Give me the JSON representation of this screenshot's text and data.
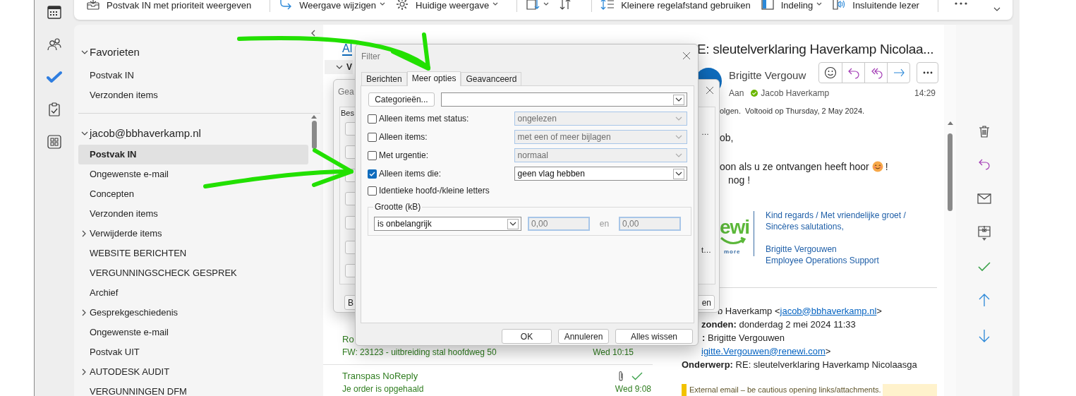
{
  "ribbon": {
    "items": [
      {
        "kind": "command",
        "label": "Postvak IN met prioriteit weergeven",
        "dropdown": false
      },
      {
        "kind": "separator"
      },
      {
        "kind": "command",
        "label": "Weergave wijzigen",
        "dropdown": true
      },
      {
        "kind": "command",
        "label": "Huidige weergave",
        "dropdown": true
      },
      {
        "kind": "separator"
      },
      {
        "kind": "icon",
        "dropdown": true
      },
      {
        "kind": "icon",
        "dropdown": false
      },
      {
        "kind": "separator"
      },
      {
        "kind": "command",
        "label": "Kleinere regelafstand gebruiken",
        "dropdown": false
      },
      {
        "kind": "command",
        "label": "Indeling",
        "dropdown": true
      },
      {
        "kind": "command",
        "label": "Insluitende lezer",
        "dropdown": false
      },
      {
        "kind": "separator"
      },
      {
        "kind": "more"
      }
    ]
  },
  "folder_pane": {
    "favorites": {
      "title": "Favorieten",
      "expanded": true,
      "items": [
        {
          "label": "Postvak IN",
          "selected": false
        },
        {
          "label": "Verzonden items",
          "selected": false
        }
      ]
    },
    "account": {
      "title": "jacob@bbhaverkamp.nl",
      "expanded": true,
      "folders": [
        {
          "label": "Postvak IN",
          "selected": true,
          "has_subfolders": false
        },
        {
          "label": "Ongewenste e-mail",
          "selected": false,
          "has_subfolders": false
        },
        {
          "label": "Concepten",
          "selected": false,
          "has_subfolders": false
        },
        {
          "label": "Verzonden items",
          "selected": false,
          "has_subfolders": false
        },
        {
          "label": "Verwijderde items",
          "selected": false,
          "has_subfolders": true
        },
        {
          "label": "WEBSITE BERICHTEN",
          "selected": false,
          "has_subfolders": false
        },
        {
          "label": "VERGUNNINGSCHECK GESPREK",
          "selected": false,
          "has_subfolders": false
        },
        {
          "label": "Archief",
          "selected": false,
          "has_subfolders": false
        },
        {
          "label": "Gesprekgeschiedenis",
          "selected": false,
          "has_subfolders": true
        },
        {
          "label": "Ongewenste e-mail",
          "selected": false,
          "has_subfolders": false
        },
        {
          "label": "Postvak UIT",
          "selected": false,
          "has_subfolders": false
        },
        {
          "label": "AUTODESK AUDIT",
          "selected": false,
          "has_subfolders": true
        },
        {
          "label": "VERGUNNINGEN DFM",
          "selected": false,
          "has_subfolders": false
        }
      ]
    }
  },
  "message_list": {
    "tab": "Al",
    "group_header": "V",
    "rows": [
      {
        "sender": "Ro",
        "subject": "FW: 23123 - uitbreiding stal hoofdweg 50",
        "time": "Wed 10:15"
      },
      {
        "sender": "Transpas NoReply",
        "subject": "Je order is opgehaald",
        "time": "Wed 9:08",
        "attachment": true,
        "completed": true
      }
    ]
  },
  "background_dialog": {
    "title": "Gea",
    "group_title": "Bes",
    "texts": [
      "…",
      "t…"
    ],
    "buttons": [
      "B",
      "en"
    ]
  },
  "filter_dialog": {
    "title": "Filter",
    "tabs": [
      {
        "label": "Berichten",
        "selected": false
      },
      {
        "label": "Meer opties",
        "selected": true
      },
      {
        "label": "Geavanceerd",
        "selected": false
      }
    ],
    "categories_button": "Categorieën...",
    "criteria": [
      {
        "label": "Alleen items met status:",
        "checked": false,
        "value": "ongelezen"
      },
      {
        "label": "Alleen items:",
        "checked": false,
        "value": "met een of meer bijlagen"
      },
      {
        "label": "Met urgentie:",
        "checked": false,
        "value": "normaal"
      },
      {
        "label": "Alleen items die:",
        "checked": true,
        "value": "geen vlag hebben"
      }
    ],
    "case_option": {
      "label": "Identieke hoofd-/kleine letters",
      "checked": false
    },
    "size_group": {
      "title": "Grootte (kB)",
      "condition": "is onbelangrijk",
      "from": "0,00",
      "and_label": "en",
      "to": "0,00",
      "disabled": true
    },
    "buttons": [
      "OK",
      "Annuleren",
      "Alles wissen"
    ]
  },
  "reading_pane": {
    "subject": "E: sleutelverklaring Haverkamp Nicolaa...",
    "sender": "Brigitte Vergouw",
    "to_label": "Aan",
    "recipient": "Jacob Haverkamp",
    "time": "14:29",
    "flag_note": "olgen.  Voltooid op Thursday, 2 May 2024.",
    "body": [
      {
        "text": "ob,",
        "emoji": false
      },
      {
        "text": "oon als u ze ontvangen heeft hoor",
        "emoji": true,
        "after": "!"
      },
      {
        "text": "nog !",
        "emoji": false
      }
    ],
    "logo": {
      "text": "ewi",
      "tagline": "more"
    },
    "signature": [
      [
        "Kind regards / Met vriendelijke groet /",
        "Sincères salutations,"
      ],
      [
        "Brigitte Vergouwen",
        "Employee Operations Support"
      ]
    ],
    "quoted": [
      {
        "text": "b Haverkamp <",
        "link": "jacob@bbhaverkamp.nl",
        "after": ">"
      },
      {
        "text": "**zonden:** donderdag 2 mei 2024 11:33"
      },
      {
        "text": "**:** Brigitte Vergouwen"
      },
      {
        "link": "igitte.Vergouwen@renewi.com",
        "after": ">"
      },
      {
        "text": "**Onderwerp:** RE: sleutelverklaring Haverkamp Nicolaasga"
      }
    ],
    "banner": "External email – be cautious opening links/attachments."
  }
}
